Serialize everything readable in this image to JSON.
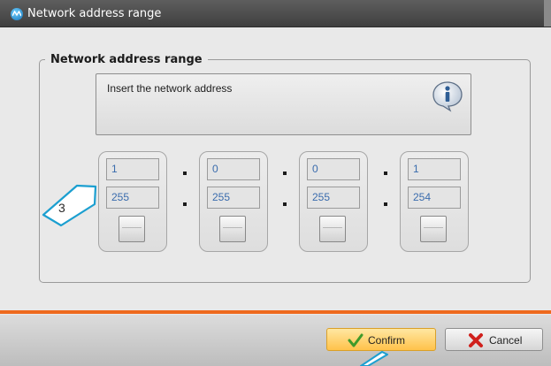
{
  "window": {
    "title": "Network address range"
  },
  "group": {
    "legend": "Network address range"
  },
  "info": {
    "text": "Insert the network address",
    "icon": "info-icon"
  },
  "octets": [
    {
      "value": "1",
      "mask": "255"
    },
    {
      "value": "0",
      "mask": "255"
    },
    {
      "value": "0",
      "mask": "255"
    },
    {
      "value": "1",
      "mask": "254"
    }
  ],
  "separator": ".",
  "callout": {
    "number": "3"
  },
  "buttons": {
    "confirm": "Confirm",
    "cancel": "Cancel"
  },
  "colors": {
    "titlebar": "#4a4a4a",
    "accent_line": "#ee6a1e",
    "confirm_bg": "#ffd36e",
    "field_text": "#3a6cad",
    "callout_border": "#1b9fd0"
  }
}
